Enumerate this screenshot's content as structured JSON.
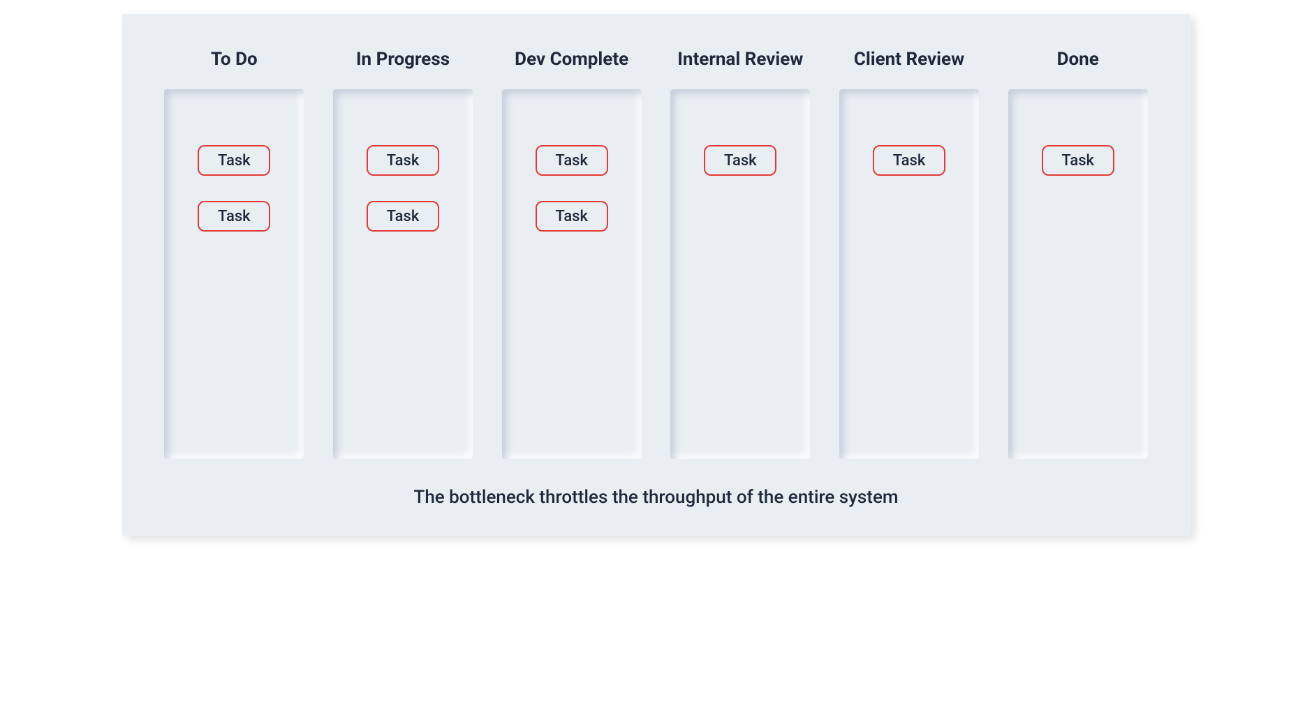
{
  "board": {
    "columns": [
      {
        "title": "To Do",
        "tasks": [
          "Task",
          "Task"
        ]
      },
      {
        "title": "In Progress",
        "tasks": [
          "Task",
          "Task"
        ]
      },
      {
        "title": "Dev Complete",
        "tasks": [
          "Task",
          "Task"
        ]
      },
      {
        "title": "Internal Review",
        "tasks": [
          "Task"
        ]
      },
      {
        "title": "Client Review",
        "tasks": [
          "Task"
        ]
      },
      {
        "title": "Done",
        "tasks": [
          "Task"
        ]
      }
    ],
    "caption": "The bottleneck throttles the throughput of the entire system"
  },
  "colors": {
    "background": "#e9eef3",
    "text": "#1e293b",
    "task_border": "#e53935"
  }
}
